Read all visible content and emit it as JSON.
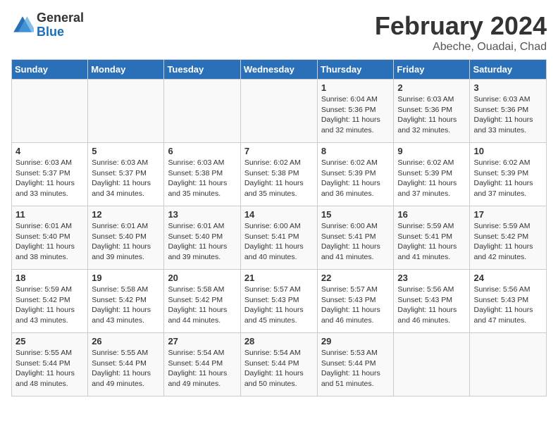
{
  "header": {
    "logo_general": "General",
    "logo_blue": "Blue",
    "title": "February 2024",
    "subtitle": "Abeche, Ouadai, Chad"
  },
  "days_of_week": [
    "Sunday",
    "Monday",
    "Tuesday",
    "Wednesday",
    "Thursday",
    "Friday",
    "Saturday"
  ],
  "weeks": [
    [
      {
        "day": "",
        "info": ""
      },
      {
        "day": "",
        "info": ""
      },
      {
        "day": "",
        "info": ""
      },
      {
        "day": "",
        "info": ""
      },
      {
        "day": "1",
        "info": "Sunrise: 6:04 AM\nSunset: 5:36 PM\nDaylight: 11 hours and 32 minutes."
      },
      {
        "day": "2",
        "info": "Sunrise: 6:03 AM\nSunset: 5:36 PM\nDaylight: 11 hours and 32 minutes."
      },
      {
        "day": "3",
        "info": "Sunrise: 6:03 AM\nSunset: 5:36 PM\nDaylight: 11 hours and 33 minutes."
      }
    ],
    [
      {
        "day": "4",
        "info": "Sunrise: 6:03 AM\nSunset: 5:37 PM\nDaylight: 11 hours and 33 minutes."
      },
      {
        "day": "5",
        "info": "Sunrise: 6:03 AM\nSunset: 5:37 PM\nDaylight: 11 hours and 34 minutes."
      },
      {
        "day": "6",
        "info": "Sunrise: 6:03 AM\nSunset: 5:38 PM\nDaylight: 11 hours and 35 minutes."
      },
      {
        "day": "7",
        "info": "Sunrise: 6:02 AM\nSunset: 5:38 PM\nDaylight: 11 hours and 35 minutes."
      },
      {
        "day": "8",
        "info": "Sunrise: 6:02 AM\nSunset: 5:39 PM\nDaylight: 11 hours and 36 minutes."
      },
      {
        "day": "9",
        "info": "Sunrise: 6:02 AM\nSunset: 5:39 PM\nDaylight: 11 hours and 37 minutes."
      },
      {
        "day": "10",
        "info": "Sunrise: 6:02 AM\nSunset: 5:39 PM\nDaylight: 11 hours and 37 minutes."
      }
    ],
    [
      {
        "day": "11",
        "info": "Sunrise: 6:01 AM\nSunset: 5:40 PM\nDaylight: 11 hours and 38 minutes."
      },
      {
        "day": "12",
        "info": "Sunrise: 6:01 AM\nSunset: 5:40 PM\nDaylight: 11 hours and 39 minutes."
      },
      {
        "day": "13",
        "info": "Sunrise: 6:01 AM\nSunset: 5:40 PM\nDaylight: 11 hours and 39 minutes."
      },
      {
        "day": "14",
        "info": "Sunrise: 6:00 AM\nSunset: 5:41 PM\nDaylight: 11 hours and 40 minutes."
      },
      {
        "day": "15",
        "info": "Sunrise: 6:00 AM\nSunset: 5:41 PM\nDaylight: 11 hours and 41 minutes."
      },
      {
        "day": "16",
        "info": "Sunrise: 5:59 AM\nSunset: 5:41 PM\nDaylight: 11 hours and 41 minutes."
      },
      {
        "day": "17",
        "info": "Sunrise: 5:59 AM\nSunset: 5:42 PM\nDaylight: 11 hours and 42 minutes."
      }
    ],
    [
      {
        "day": "18",
        "info": "Sunrise: 5:59 AM\nSunset: 5:42 PM\nDaylight: 11 hours and 43 minutes."
      },
      {
        "day": "19",
        "info": "Sunrise: 5:58 AM\nSunset: 5:42 PM\nDaylight: 11 hours and 43 minutes."
      },
      {
        "day": "20",
        "info": "Sunrise: 5:58 AM\nSunset: 5:42 PM\nDaylight: 11 hours and 44 minutes."
      },
      {
        "day": "21",
        "info": "Sunrise: 5:57 AM\nSunset: 5:43 PM\nDaylight: 11 hours and 45 minutes."
      },
      {
        "day": "22",
        "info": "Sunrise: 5:57 AM\nSunset: 5:43 PM\nDaylight: 11 hours and 46 minutes."
      },
      {
        "day": "23",
        "info": "Sunrise: 5:56 AM\nSunset: 5:43 PM\nDaylight: 11 hours and 46 minutes."
      },
      {
        "day": "24",
        "info": "Sunrise: 5:56 AM\nSunset: 5:43 PM\nDaylight: 11 hours and 47 minutes."
      }
    ],
    [
      {
        "day": "25",
        "info": "Sunrise: 5:55 AM\nSunset: 5:44 PM\nDaylight: 11 hours and 48 minutes."
      },
      {
        "day": "26",
        "info": "Sunrise: 5:55 AM\nSunset: 5:44 PM\nDaylight: 11 hours and 49 minutes."
      },
      {
        "day": "27",
        "info": "Sunrise: 5:54 AM\nSunset: 5:44 PM\nDaylight: 11 hours and 49 minutes."
      },
      {
        "day": "28",
        "info": "Sunrise: 5:54 AM\nSunset: 5:44 PM\nDaylight: 11 hours and 50 minutes."
      },
      {
        "day": "29",
        "info": "Sunrise: 5:53 AM\nSunset: 5:44 PM\nDaylight: 11 hours and 51 minutes."
      },
      {
        "day": "",
        "info": ""
      },
      {
        "day": "",
        "info": ""
      }
    ]
  ]
}
